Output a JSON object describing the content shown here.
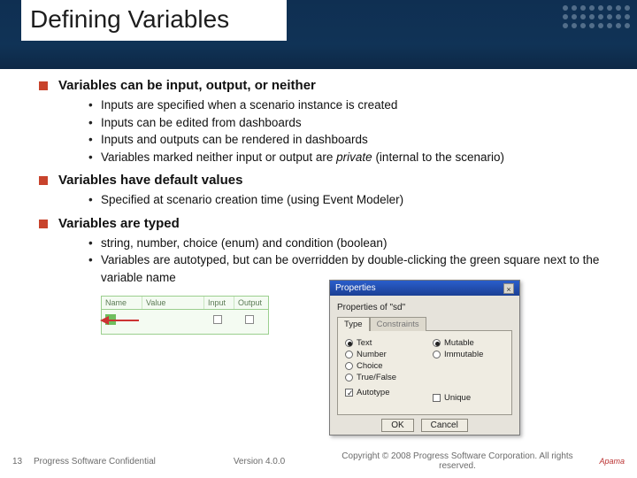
{
  "title": "Defining Variables",
  "sections": [
    {
      "heading": "Variables can be input, output, or neither",
      "bullets": [
        "Inputs are specified when a scenario instance is created",
        "Inputs can be edited from dashboards",
        "Inputs and outputs can be rendered in dashboards",
        {
          "pre": "Variables marked neither input or output are ",
          "em": "private",
          "post": " (internal to the scenario)"
        }
      ]
    },
    {
      "heading": "Variables have default values",
      "bullets": [
        "Specified at scenario creation time (using Event Modeler)"
      ]
    },
    {
      "heading": "Variables are typed",
      "bullets": [
        "string, number, choice (enum) and condition (boolean)",
        "Variables are autotyped, but can be overridden by double-clicking the green square next to the variable name"
      ]
    }
  ],
  "green_table": {
    "headers": [
      "Name",
      "Value",
      "Input",
      "Output"
    ]
  },
  "dialog": {
    "title": "Properties",
    "caption": "Properties of \"sd\"",
    "tabs": [
      "Type",
      "Constraints"
    ],
    "left_options": [
      "Text",
      "Number",
      "Choice",
      "True/False"
    ],
    "right_options": [
      "Mutable",
      "Immutable"
    ],
    "autotype": "Autotype",
    "unique": "Unique",
    "buttons": [
      "OK",
      "Cancel"
    ]
  },
  "footer": {
    "page": "13",
    "confidential": "Progress Software Confidential",
    "version": "Version 4.0.0",
    "copyright": "Copyright © 2008 Progress Software Corporation. All rights reserved.",
    "logo": "Apama"
  }
}
